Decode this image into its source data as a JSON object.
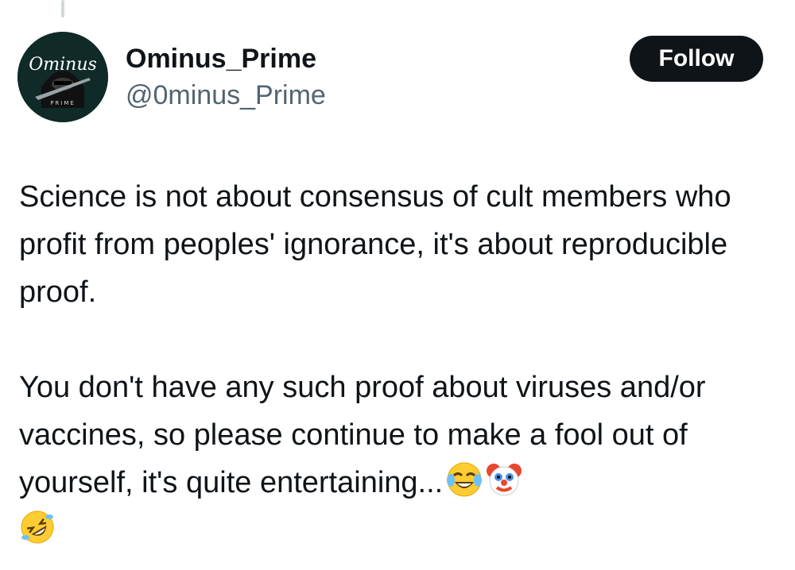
{
  "tweet": {
    "author": {
      "display_name": "Ominus_Prime",
      "handle": "@0minus_Prime",
      "avatar_icon": "avatar-ominus-logo",
      "avatar_logo_text": "Ominus",
      "avatar_sub_text": "PRIME"
    },
    "follow_label": "Follow",
    "paragraphs": [
      "Science is not about consensus of cult members who profit from peoples' ignorance, it's about reproducible proof.",
      "You don't have any such proof about viruses and/or vaccines, so please continue to make a fool out of yourself, it's quite entertaining..."
    ],
    "emojis": [
      "face-with-tears-of-joy",
      "clown-face",
      "rolling-on-floor-laughing"
    ]
  },
  "colors": {
    "text": "#0f1419",
    "secondary": "#536471",
    "button_bg": "#0f1419",
    "button_text": "#ffffff",
    "avatar_bg": "#0f2a27"
  }
}
